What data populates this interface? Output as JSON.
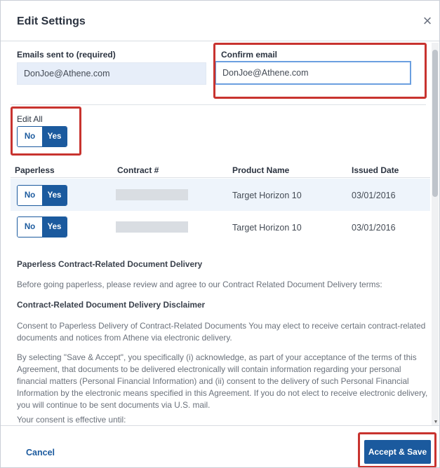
{
  "dialog": {
    "title": "Edit Settings",
    "close_symbol": "×"
  },
  "email": {
    "label": "Emails sent to (required)",
    "value": "DonJoe@Athene.com"
  },
  "confirm_email": {
    "label": "Confirm email",
    "value": "DonJoe@Athene.com"
  },
  "edit_all": {
    "label": "Edit All",
    "no_label": "No",
    "yes_label": "Yes",
    "selected": "Yes"
  },
  "table": {
    "headers": [
      "Paperless",
      "Contract #",
      "Product Name",
      "Issued Date"
    ],
    "rows": [
      {
        "no_label": "No",
        "yes_label": "Yes",
        "product": "Target Horizon 10",
        "issued": "03/01/2016"
      },
      {
        "no_label": "No",
        "yes_label": "Yes",
        "product": "Target Horizon 10",
        "issued": "03/01/2016"
      }
    ]
  },
  "terms": {
    "heading": "Paperless Contract-Related Document Delivery",
    "intro": "Before going paperless, please review and agree to our Contract Related Document Delivery terms:",
    "disclaimer_heading": "Contract-Related Document Delivery Disclaimer",
    "consent": "Consent to Paperless Delivery of Contract-Related Documents You may elect to receive certain contract-related documents and notices from Athene via electronic delivery.",
    "selecting": "By selecting \"Save & Accept\", you specifically (i) acknowledge, as part of your acceptance of the terms of this Agreement, that documents to be delivered electronically will contain information regarding your personal financial matters (Personal Financial Information) and (ii) consent to the delivery of such Personal Financial Information by the electronic means specified in this Agreement. If you do not elect to receive electronic delivery, you will continue to be sent documents via U.S. mail.",
    "effective": "Your consent is effective until:"
  },
  "footer": {
    "cancel_label": "Cancel",
    "accept_label": "Accept & Save"
  },
  "colors": {
    "primary": "#1b5a9e",
    "highlight": "#c8332f"
  }
}
